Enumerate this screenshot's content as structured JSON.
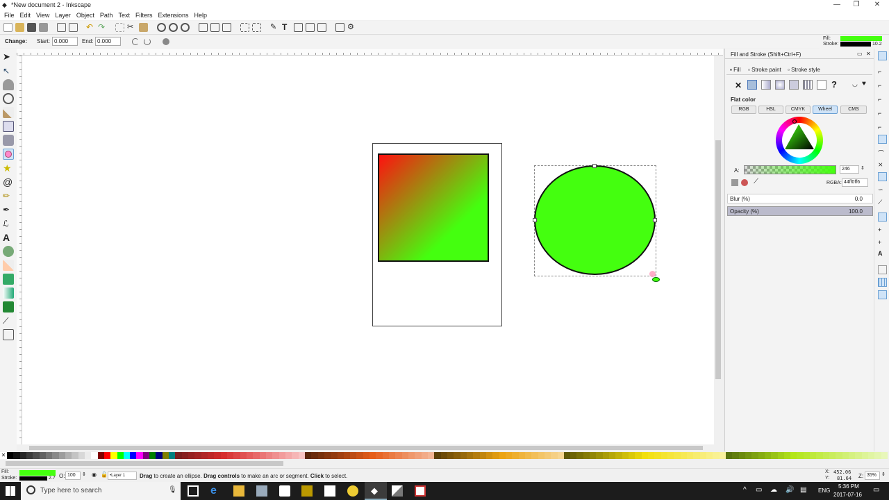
{
  "window": {
    "title": "*New document 2 - Inkscape",
    "min": "—",
    "max": "❐",
    "close": "✕"
  },
  "menu": [
    "File",
    "Edit",
    "View",
    "Layer",
    "Object",
    "Path",
    "Text",
    "Filters",
    "Extensions",
    "Help"
  ],
  "ctrl": {
    "change_label": "Change:",
    "start_label": "Start:",
    "start_value": "0.000",
    "end_label": "End:",
    "end_value": "0.000"
  },
  "style_indicator": {
    "fill_label": "Fill:",
    "stroke_label": "Stroke:",
    "stroke_width": "10.2",
    "fill_color": "#44ff0f",
    "stroke_color": "#000000"
  },
  "canvas": {
    "square_gradient_from": "#ff1010",
    "square_gradient_to": "#44ff0f",
    "circle_fill": "#44ff0f"
  },
  "panel": {
    "title": "Fill and Stroke (Shift+Ctrl+F)",
    "tabs": [
      "Fill",
      "Stroke paint",
      "Stroke style"
    ],
    "paint_mode_x": "✕",
    "paint_mode_q": "?",
    "paint_label": "Flat color",
    "modes": [
      "RGB",
      "HSL",
      "CMYK",
      "Wheel",
      "CMS"
    ],
    "active_mode": "Wheel",
    "alpha_label": "A:",
    "alpha_value": "246",
    "rgba_label": "RGBA:",
    "rgba_value": "44ff0ff6",
    "blur_label": "Blur (%)",
    "blur_value": "0.0",
    "opacity_label": "Opacity (%)",
    "opacity_value": "100.0"
  },
  "status": {
    "fill_label": "Fill:",
    "stroke_label": "Stroke:",
    "stroke_width": "2.7",
    "opacity_label": "O:",
    "opacity_value": "100",
    "layer": "•Layer 1",
    "message_pre": "Drag",
    "message_mid1": " to create an ellipse. ",
    "message_bold2": "Drag controls",
    "message_mid2": " to make an arc or segment. ",
    "message_bold3": "Click",
    "message_end": " to select.",
    "x_label": "X:",
    "x_value": "452.06",
    "y_label": "Y:",
    "y_value": "81.64",
    "zoom_label": "Z:",
    "zoom_value": "35%"
  },
  "taskbar": {
    "search_placeholder": "Type here to search",
    "lang": "ENG",
    "time": "5:36 PM",
    "date": "2017-07-16"
  }
}
